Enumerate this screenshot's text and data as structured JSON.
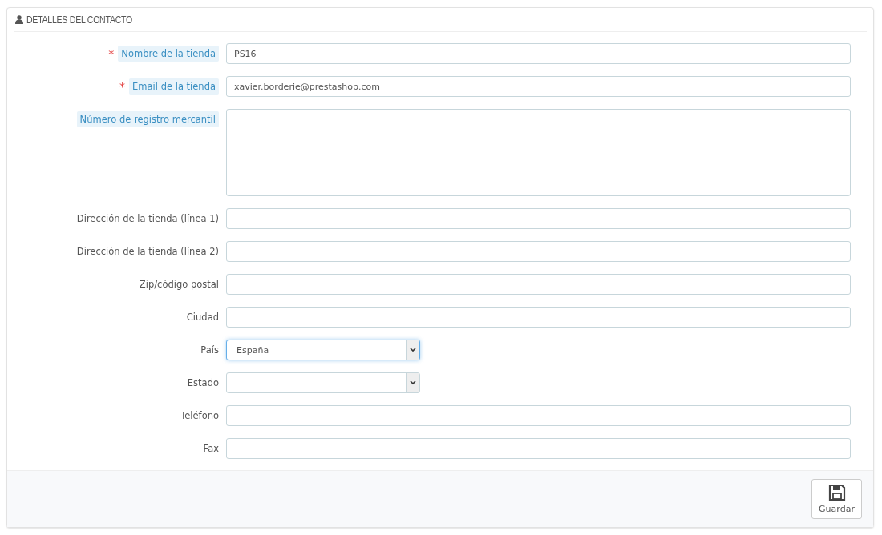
{
  "panel": {
    "title": "DETALLES DEL CONTACTO"
  },
  "fields": [
    {
      "kind": "text",
      "label": "Nombre de la tienda",
      "required_mark": "*",
      "hint": true,
      "value": "PS16",
      "focused": false
    },
    {
      "kind": "text",
      "label": "Email de la tienda",
      "required_mark": "*",
      "hint": true,
      "value": "xavier.borderie@prestashop.com",
      "focused": false
    },
    {
      "kind": "textarea",
      "label": "Número de registro mercantil",
      "hint": true,
      "focused": false
    },
    {
      "kind": "text",
      "label": "Dirección de la tienda (línea 1)",
      "hint": false,
      "focused": false
    },
    {
      "kind": "text",
      "label": "Dirección de la tienda (línea 2)",
      "hint": false,
      "focused": false
    },
    {
      "kind": "text",
      "label": "Zip/código postal",
      "hint": false,
      "focused": false
    },
    {
      "kind": "text",
      "label": "Ciudad",
      "hint": false,
      "focused": false
    },
    {
      "kind": "select",
      "label": "País",
      "hint": false,
      "value": "España",
      "focused": true
    },
    {
      "kind": "select",
      "label": "Estado",
      "hint": false,
      "value": "-",
      "focused": false
    },
    {
      "kind": "text",
      "label": "Teléfono",
      "hint": false,
      "focused": false
    },
    {
      "kind": "text",
      "label": "Fax",
      "hint": false,
      "focused": false
    }
  ],
  "footer": {
    "save_button": "Guardar"
  }
}
